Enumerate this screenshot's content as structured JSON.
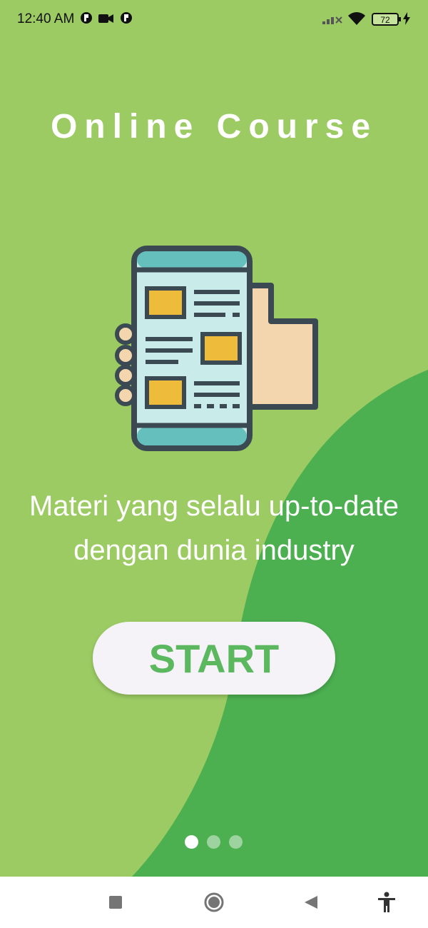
{
  "status_bar": {
    "time": "12:40 AM",
    "icons": [
      "notification-icon",
      "video-camera-icon",
      "notification-icon",
      "signal-icon",
      "wifi-icon",
      "battery-icon",
      "charging-icon"
    ],
    "battery_level": "72"
  },
  "onboarding": {
    "title": "Online Course",
    "tagline_line1": "Materi yang selalu up-to-date",
    "tagline_line2": "dengan dunia industry",
    "start_label": "START",
    "page_count": 3,
    "current_page": 1
  },
  "nav_bar": {
    "buttons": [
      "recents-square-icon",
      "home-circle-icon",
      "back-triangle-icon",
      "accessibility-icon"
    ]
  },
  "colors": {
    "background_light": "#9ccb63",
    "background_dark": "#4caf50",
    "button_bg": "#f5f2f8",
    "button_text": "#5cb85f",
    "text": "#ffffff"
  }
}
